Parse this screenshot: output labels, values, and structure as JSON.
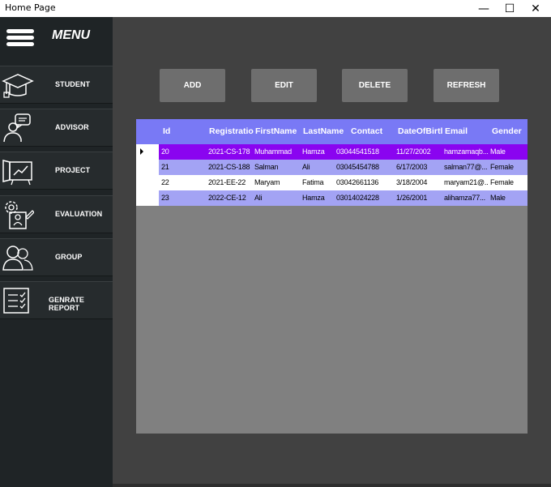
{
  "window": {
    "title": "Home Page",
    "min": "—",
    "max": "☐",
    "close": "✕"
  },
  "sidebar": {
    "menu_label": "MENU",
    "items": [
      {
        "label": "STUDENT",
        "icon": "graduation-cap-icon"
      },
      {
        "label": "ADVISOR",
        "icon": "advisor-chat-icon"
      },
      {
        "label": "PROJECT",
        "icon": "project-chart-icon"
      },
      {
        "label": "EVALUATION",
        "icon": "evaluation-icon"
      },
      {
        "label": "GROUP",
        "icon": "group-icon"
      },
      {
        "label": "GENRATE REPORT",
        "icon": "report-checklist-icon"
      }
    ]
  },
  "toolbar": {
    "add_label": "ADD",
    "edit_label": "EDIT",
    "delete_label": "DELETE",
    "refresh_label": "REFRESH"
  },
  "grid": {
    "columns": [
      "Id",
      "Registratio",
      "FirstName",
      "LastName",
      "Contact",
      "DateOfBirtl",
      "Email",
      "Gender"
    ],
    "rows": [
      [
        "20",
        "2021-CS-178",
        "Muhammad",
        "Hamza",
        "03044541518",
        "11/27/2002",
        "hamzamaqb...",
        "Male"
      ],
      [
        "21",
        "2021-CS-188",
        "Salman",
        "Ali",
        "03045454788",
        "6/17/2003",
        "salman77@...",
        "Female"
      ],
      [
        "22",
        "2021-EE-22",
        "Maryam",
        "Fatima",
        "03042661136",
        "3/18/2004",
        "maryam21@...",
        "Female"
      ],
      [
        "23",
        "2022-CE-12",
        "Ali",
        "Hamza",
        "03014024228",
        "1/26/2001",
        "alihamza77...",
        "Male"
      ]
    ],
    "selected_row": 0
  },
  "colors": {
    "sidebar_bg": "#1f2426",
    "main_bg": "#414141",
    "header_bg": "#7979f5",
    "selected_row": "#8a04f0",
    "alt_row": "#a3a3f4"
  }
}
